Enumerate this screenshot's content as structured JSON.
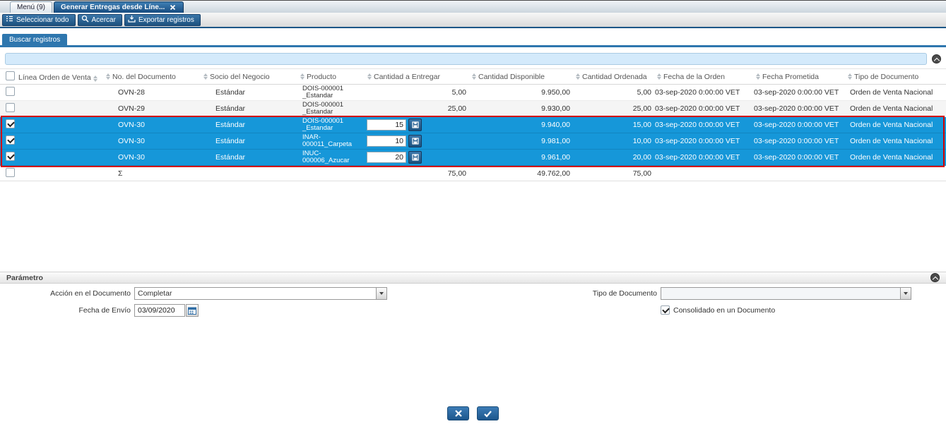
{
  "window": {
    "tabs": [
      {
        "label": "Menú (9)",
        "active": false
      },
      {
        "label": "Generar Entregas desde Líne...",
        "active": true
      }
    ]
  },
  "toolbar": {
    "buttons": [
      {
        "label": "Seleccionar todo",
        "icon": "select-all-icon"
      },
      {
        "label": "Acercar",
        "icon": "zoom-icon"
      },
      {
        "label": "Exportar registros",
        "icon": "export-icon"
      }
    ]
  },
  "search": {
    "tab_label": "Buscar registros",
    "input_value": ""
  },
  "table": {
    "columns": [
      "Línea Orden de Venta",
      "No. del Documento",
      "Socio del Negocio",
      "Producto",
      "Cantidad a Entregar",
      "Cantidad Disponible",
      "Cantidad Ordenada",
      "Fecha de la Orden",
      "Fecha Prometida",
      "Tipo de Documento"
    ],
    "rows": [
      {
        "document": "OVN-28",
        "partner": "Estándar",
        "product": "DOIS-000001 _Estandar",
        "qty_to_deliver": "5,00",
        "qty_available": "9.950,00",
        "qty_ordered": "5,00",
        "order_date": "03-sep-2020 0:00:00 VET",
        "promised_date": "03-sep-2020 0:00:00 VET",
        "doc_type": "Orden de Venta Nacional"
      },
      {
        "document": "OVN-29",
        "partner": "Estándar",
        "product": "DOIS-000001 _Estandar",
        "qty_to_deliver": "25,00",
        "qty_available": "9.930,00",
        "qty_ordered": "25,00",
        "order_date": "03-sep-2020 0:00:00 VET",
        "promised_date": "03-sep-2020 0:00:00 VET",
        "doc_type": "Orden de Venta Nacional"
      },
      {
        "document": "OVN-30",
        "partner": "Estándar",
        "product": "DOIS-000001 _Estandar",
        "qty_input": "15",
        "qty_available": "9.940,00",
        "qty_ordered": "15,00",
        "order_date": "03-sep-2020 0:00:00 VET",
        "promised_date": "03-sep-2020 0:00:00 VET",
        "doc_type": "Orden de Venta Nacional"
      },
      {
        "document": "OVN-30",
        "partner": "Estándar",
        "product": "INAR-000011_Carpeta",
        "qty_input": "10",
        "qty_available": "9.981,00",
        "qty_ordered": "10,00",
        "order_date": "03-sep-2020 0:00:00 VET",
        "promised_date": "03-sep-2020 0:00:00 VET",
        "doc_type": "Orden de Venta Nacional"
      },
      {
        "document": "OVN-30",
        "partner": "Estándar",
        "product": "INUC-000006_Azucar",
        "qty_input": "20",
        "qty_available": "9.961,00",
        "qty_ordered": "20,00",
        "order_date": "03-sep-2020 0:00:00 VET",
        "promised_date": "03-sep-2020 0:00:00 VET",
        "doc_type": "Orden de Venta Nacional"
      }
    ],
    "footer": {
      "sum_symbol": "Σ",
      "qty_to_deliver": "75,00",
      "qty_available": "49.762,00",
      "qty_ordered": "75,00"
    }
  },
  "parameters": {
    "title": "Parámetro",
    "doc_action_label": "Acción en el Documento",
    "doc_action_value": "Completar",
    "doc_type_label": "Tipo de Documento",
    "doc_type_value": "",
    "ship_date_label": "Fecha de Envío",
    "ship_date_value": "03/09/2020",
    "consolidated_label": "Consolidado en un Documento"
  },
  "actions": {
    "cancel_icon": "x-icon",
    "confirm_icon": "check-icon"
  },
  "colors": {
    "selection_blue": "#1697d9",
    "highlight_red": "#d40000",
    "toolbar_blue": "#1c5687",
    "tab_blue": "#2e76ae"
  }
}
